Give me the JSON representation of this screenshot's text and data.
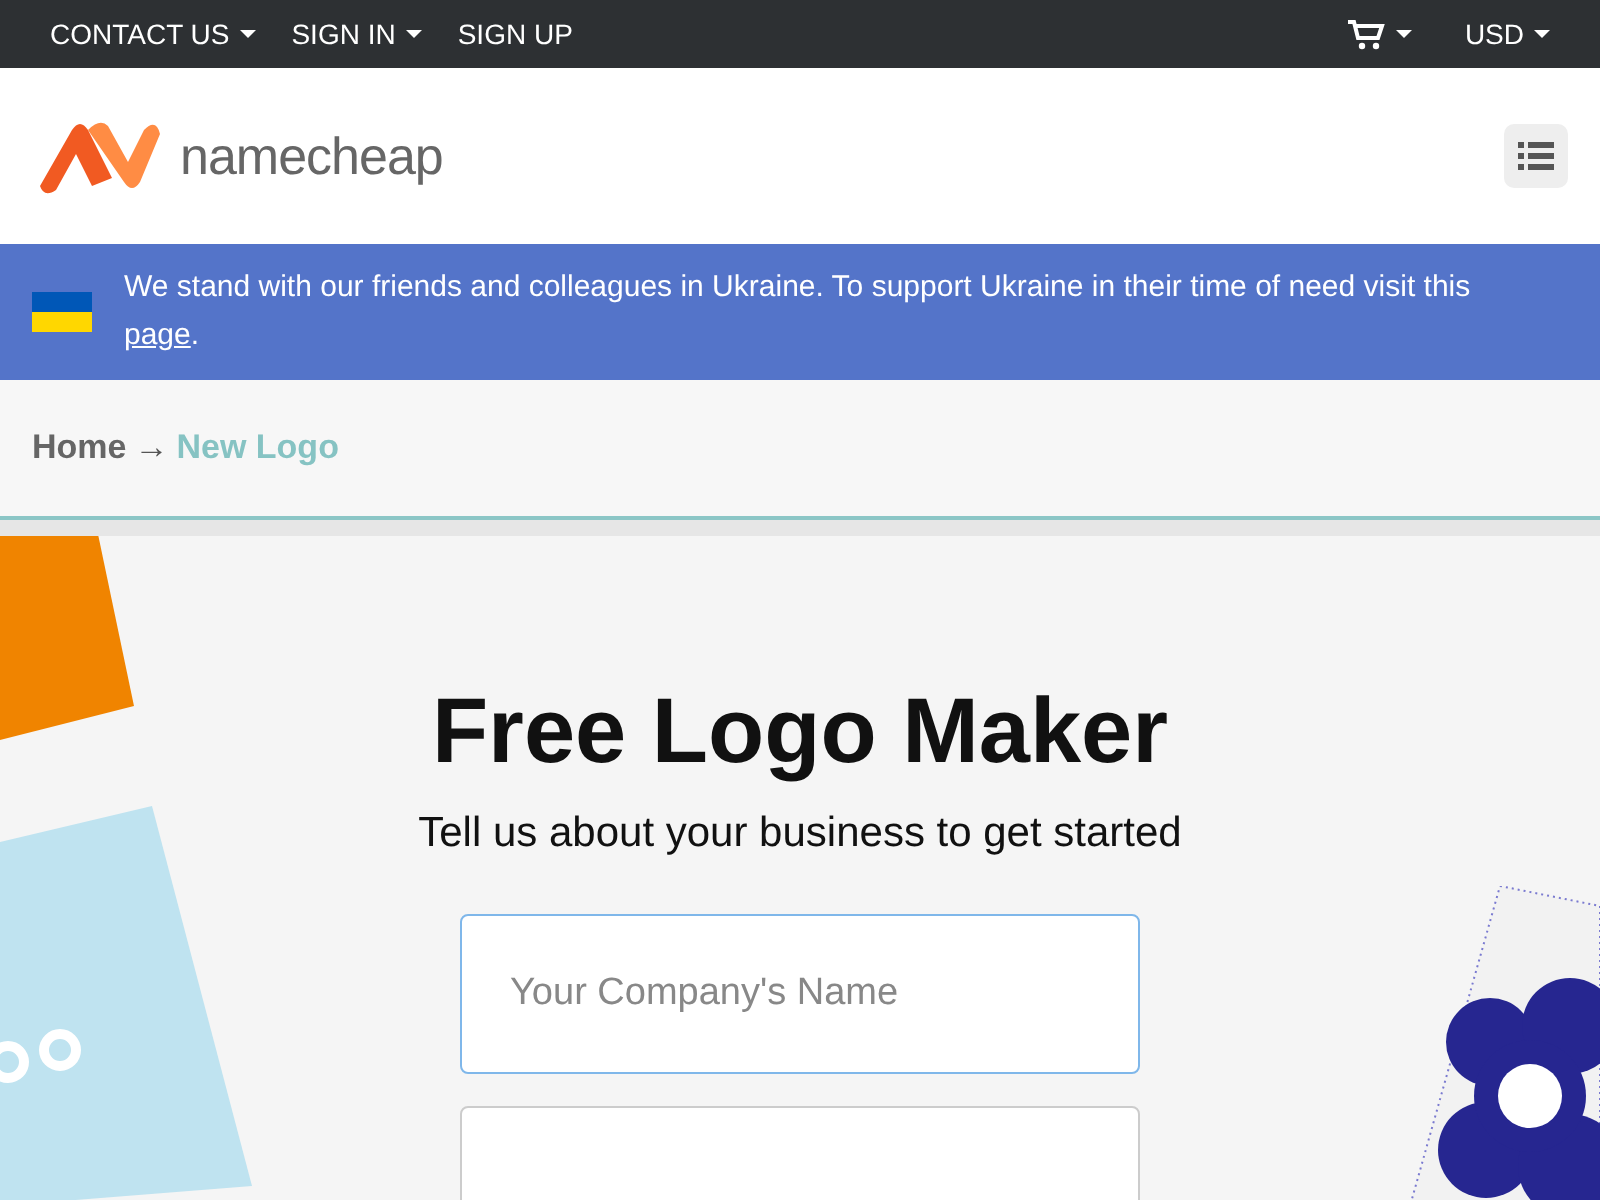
{
  "top_bar": {
    "left_links": [
      {
        "label": "CONTACT US",
        "dropdown": true
      },
      {
        "label": "SIGN IN",
        "dropdown": true
      },
      {
        "label": "SIGN UP",
        "dropdown": false
      }
    ],
    "cart": {
      "dropdown": true
    },
    "currency": {
      "label": "USD",
      "dropdown": true
    }
  },
  "header": {
    "logo_text": "namecheap"
  },
  "banner": {
    "text": "We stand with our friends and colleagues in Ukraine. To support Ukraine in their time of need visit this ",
    "link": "page",
    "after": "."
  },
  "breadcrumb": {
    "separator": "→",
    "items": [
      {
        "label": "Home",
        "current": false
      },
      {
        "label": "New Logo",
        "current": true
      }
    ]
  },
  "hero": {
    "title": "Free Logo Maker",
    "subtitle": "Tell us about your business to get started",
    "fields": [
      {
        "placeholder": "Your Company's Name",
        "focused": true
      },
      {
        "focused": false
      }
    ]
  }
}
